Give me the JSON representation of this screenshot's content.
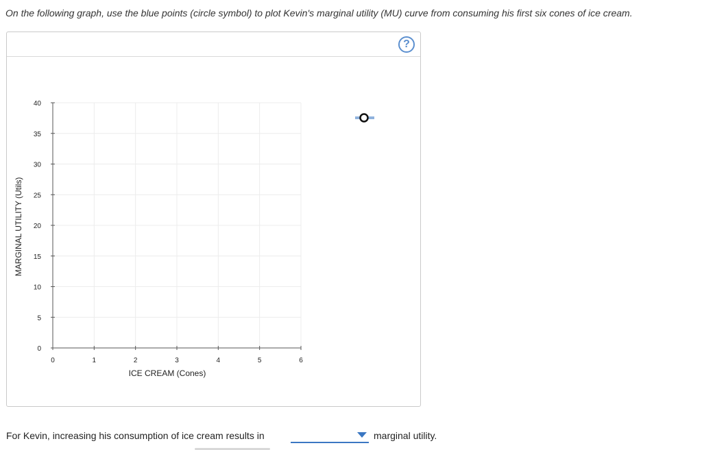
{
  "instruction": "On the following graph, use the blue points (circle symbol) to plot Kevin's marginal utility (MU) curve from consuming his first six cones of ice cream.",
  "help_label": "?",
  "question": {
    "prefix": "For Kevin, increasing his consumption of ice cream results in",
    "selected": "",
    "suffix": "marginal utility."
  },
  "colors": {
    "accent": "#3a77c2",
    "tool_line": "#8fb2dd",
    "grid": "#ececec",
    "axis": "#555555"
  },
  "chart_data": {
    "type": "scatter",
    "xlabel": "ICE CREAM (Cones)",
    "ylabel": "MARGINAL UTILITY (Utils)",
    "xlim": [
      0,
      6
    ],
    "ylim": [
      0,
      40
    ],
    "x_ticks": [
      0,
      1,
      2,
      3,
      4,
      5,
      6
    ],
    "y_ticks": [
      0,
      5,
      10,
      15,
      20,
      25,
      30,
      35,
      40
    ],
    "grid": true,
    "series": [
      {
        "values": []
      }
    ],
    "tool_icon": "blue-circle-point-tool"
  }
}
